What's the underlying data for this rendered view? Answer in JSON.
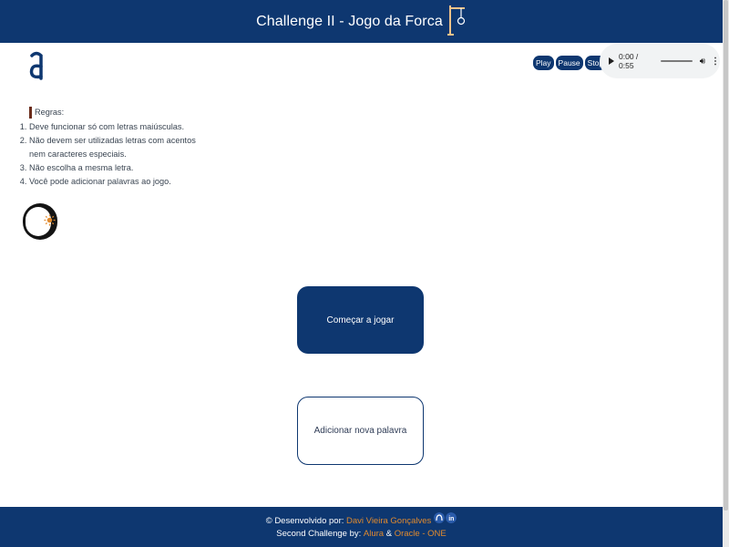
{
  "header": {
    "title": "Challenge II - Jogo da Forca",
    "gallows_icon": "gallows-icon"
  },
  "logo": {
    "letter": "a",
    "icon": "alura-logo-icon",
    "color": "#0e3770"
  },
  "audio": {
    "buttons": {
      "play": "Play",
      "pause": "Pause",
      "stop": "Stop"
    },
    "time": "0:00 / 0:55",
    "progress": 0
  },
  "rules": {
    "heading": "Regras:",
    "items": [
      "Deve funcionar só com letras maiúsculas.",
      "Não devem ser utilizadas letras com acentos nem caracteres especiais.",
      "Não escolha a mesma letra.",
      "Você pode adicionar palavras ao jogo."
    ],
    "item2_line1": "Não devem ser utilizadas letras com acentos",
    "item2_line2": "nem caracteres especiais."
  },
  "theme_toggle": {
    "icon": "sun-icon",
    "state": "light"
  },
  "main": {
    "start_button": "Começar a jogar",
    "add_word_button": "Adicionar nova palavra"
  },
  "footer": {
    "line1_prefix": "© Desenvolvido por:",
    "author": "Davi Vieira Gonçalves",
    "line2_prefix": "Second Challenge by:",
    "sponsor1": "Alura",
    "amp": "&",
    "sponsor2": "Oracle - ONE",
    "social_icons": [
      "github-icon",
      "linkedin-icon"
    ]
  },
  "colors": {
    "primary": "#0e3770",
    "accent": "#e08a2e",
    "toggle_bg": "#141414"
  }
}
